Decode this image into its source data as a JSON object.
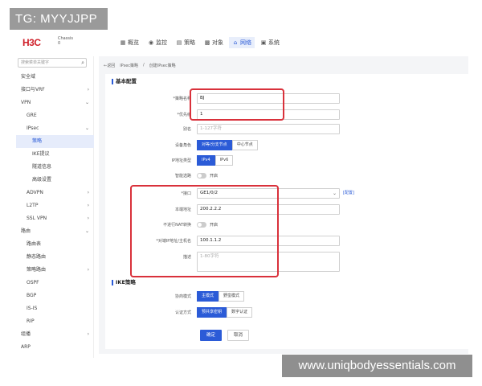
{
  "watermark_top": "TG: MYYJJPP",
  "watermark_bottom": "www.uniqbodyessentials.com",
  "brand": {
    "logo": "H3C",
    "sub_line1": "Chassis",
    "sub_line2": "0"
  },
  "topnav": [
    {
      "label": "概览",
      "icon": "grid-icon"
    },
    {
      "label": "监控",
      "icon": "monitor-icon"
    },
    {
      "label": "策略",
      "icon": "policy-icon"
    },
    {
      "label": "对象",
      "icon": "object-icon"
    },
    {
      "label": "网络",
      "icon": "network-icon",
      "active": true
    },
    {
      "label": "系统",
      "icon": "system-icon"
    }
  ],
  "sidebar": {
    "search_placeholder": "搜索菜单关键字",
    "items": [
      {
        "label": "安全域",
        "level": 1
      },
      {
        "label": "接口与VRF",
        "level": 1,
        "chevron": "›"
      },
      {
        "label": "VPN",
        "level": 1,
        "chevron": "⌄"
      },
      {
        "label": "GRE",
        "level": 2
      },
      {
        "label": "IPsec",
        "level": 2,
        "chevron": "⌄"
      },
      {
        "label": "策略",
        "level": 3,
        "active": true
      },
      {
        "label": "IKE提议",
        "level": 3
      },
      {
        "label": "隧道信息",
        "level": 3
      },
      {
        "label": "高级设置",
        "level": 3
      },
      {
        "label": "ADVPN",
        "level": 2,
        "chevron": "›"
      },
      {
        "label": "L2TP",
        "level": 2,
        "chevron": "›"
      },
      {
        "label": "SSL VPN",
        "level": 2,
        "chevron": "›"
      },
      {
        "label": "路由",
        "level": 1,
        "chevron": "⌄"
      },
      {
        "label": "路由表",
        "level": 2
      },
      {
        "label": "静态路由",
        "level": 2
      },
      {
        "label": "策略路由",
        "level": 2,
        "chevron": "›"
      },
      {
        "label": "OSPF",
        "level": 2
      },
      {
        "label": "BGP",
        "level": 2
      },
      {
        "label": "IS-IS",
        "level": 2
      },
      {
        "label": "RIP",
        "level": 2
      },
      {
        "label": "组播",
        "level": 1,
        "chevron": "›"
      },
      {
        "label": "ARP",
        "level": 1
      }
    ]
  },
  "breadcrumb": {
    "back": "←返回",
    "part1": "IPsec策略",
    "sep": "/",
    "part2": "创建IPsec策略"
  },
  "sections": {
    "basic": "基本配置",
    "ike": "IKE策略"
  },
  "form": {
    "name_label": "*策略名称",
    "name_value": "BJ",
    "priority_label": "*优先级",
    "priority_value": "1",
    "alias_label": "别名",
    "alias_placeholder": "1-127字符",
    "role_label": "设备角色",
    "role_opt1": "对等/分支节点",
    "role_opt2": "中心节点",
    "ip_label": "IP地址类型",
    "ip_opt1": "IPv4",
    "ip_opt2": "IPv6",
    "smart_label": "智能选路",
    "smart_toggle": "开启",
    "iface_label": "*接口",
    "iface_value": "GE1/0/2",
    "iface_link": "[配置]",
    "local_label": "本端地址",
    "local_value": "200.2.2.2",
    "nat_label": "不进行NAT转换",
    "nat_toggle": "开启",
    "peer_label": "*对端IP地址/主机名",
    "peer_value": "100.1.1.2",
    "desc_label": "描述",
    "desc_placeholder": "1-80字符",
    "mode_label": "协商模式",
    "mode_opt1": "主模式",
    "mode_opt2": "野蛮模式",
    "auth_label": "认证方式",
    "auth_opt1": "预共享密钥",
    "auth_opt2": "数字认证"
  },
  "actions": {
    "ok": "确定",
    "cancel": "取消"
  },
  "colors": {
    "accent": "#2b5bd7",
    "highlight": "#d9313b",
    "brand": "#d0222c"
  }
}
